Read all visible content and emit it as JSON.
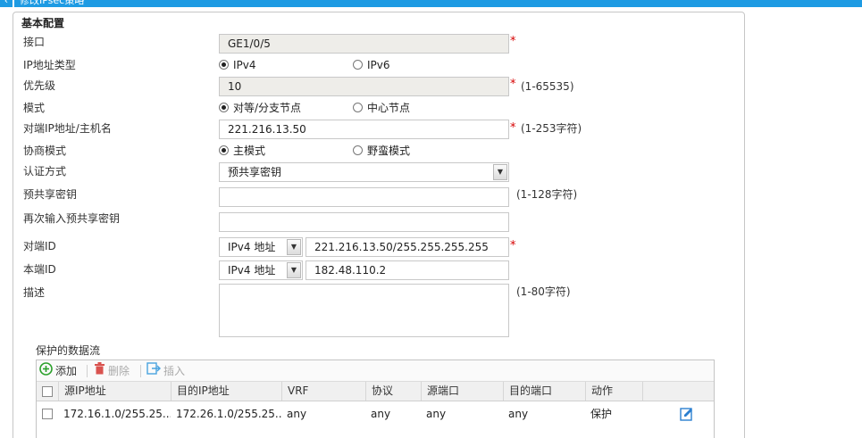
{
  "window": {
    "title": "修改IPsec策略",
    "back_glyph": "‹"
  },
  "section_title": "基本配置",
  "required_mark": "*",
  "fields": {
    "interface": {
      "label": "接口",
      "value": "GE1/0/5"
    },
    "ip_type": {
      "label": "IP地址类型",
      "options": [
        "IPv4",
        "IPv6"
      ],
      "selected": "IPv4"
    },
    "priority": {
      "label": "优先级",
      "value": "10",
      "hint": "(1-65535)"
    },
    "mode": {
      "label": "模式",
      "options": [
        "对等/分支节点",
        "中心节点"
      ],
      "selected": "对等/分支节点"
    },
    "peer_address": {
      "label": "对端IP地址/主机名",
      "value": "221.216.13.50",
      "hint": "(1-253字符)"
    },
    "negotiation_mode": {
      "label": "协商模式",
      "options": [
        "主模式",
        "野蛮模式"
      ],
      "selected": "主模式"
    },
    "auth_method": {
      "label": "认证方式",
      "value": "预共享密钥"
    },
    "psk": {
      "label": "预共享密钥",
      "value": "",
      "hint": "(1-128字符)"
    },
    "psk_confirm": {
      "label": "再次输入预共享密钥",
      "value": ""
    },
    "peer_id": {
      "label": "对端ID",
      "type": "IPv4 地址",
      "value": "221.216.13.50/255.255.255.255"
    },
    "local_id": {
      "label": "本端ID",
      "type": "IPv4 地址",
      "value": "182.48.110.2"
    },
    "description": {
      "label": "描述",
      "value": "",
      "hint": "(1-80字符)"
    }
  },
  "flows": {
    "label": "保护的数据流",
    "toolbar": {
      "add": "添加",
      "delete": "删除",
      "insert": "插入"
    },
    "columns": [
      "源IP地址",
      "目的IP地址",
      "VRF",
      "协议",
      "源端口",
      "目的端口",
      "动作"
    ],
    "rows": [
      {
        "src": "172.16.1.0/255.25...",
        "dst": "172.26.1.0/255.25...",
        "vrf": "any",
        "protocol": "any",
        "src_port": "any",
        "dst_port": "any",
        "action": "保护"
      }
    ]
  },
  "colors": {
    "accent": "#1e9be3",
    "required": "#d60000",
    "add_green": "#2aa02a",
    "delete_red": "#d9534f"
  }
}
